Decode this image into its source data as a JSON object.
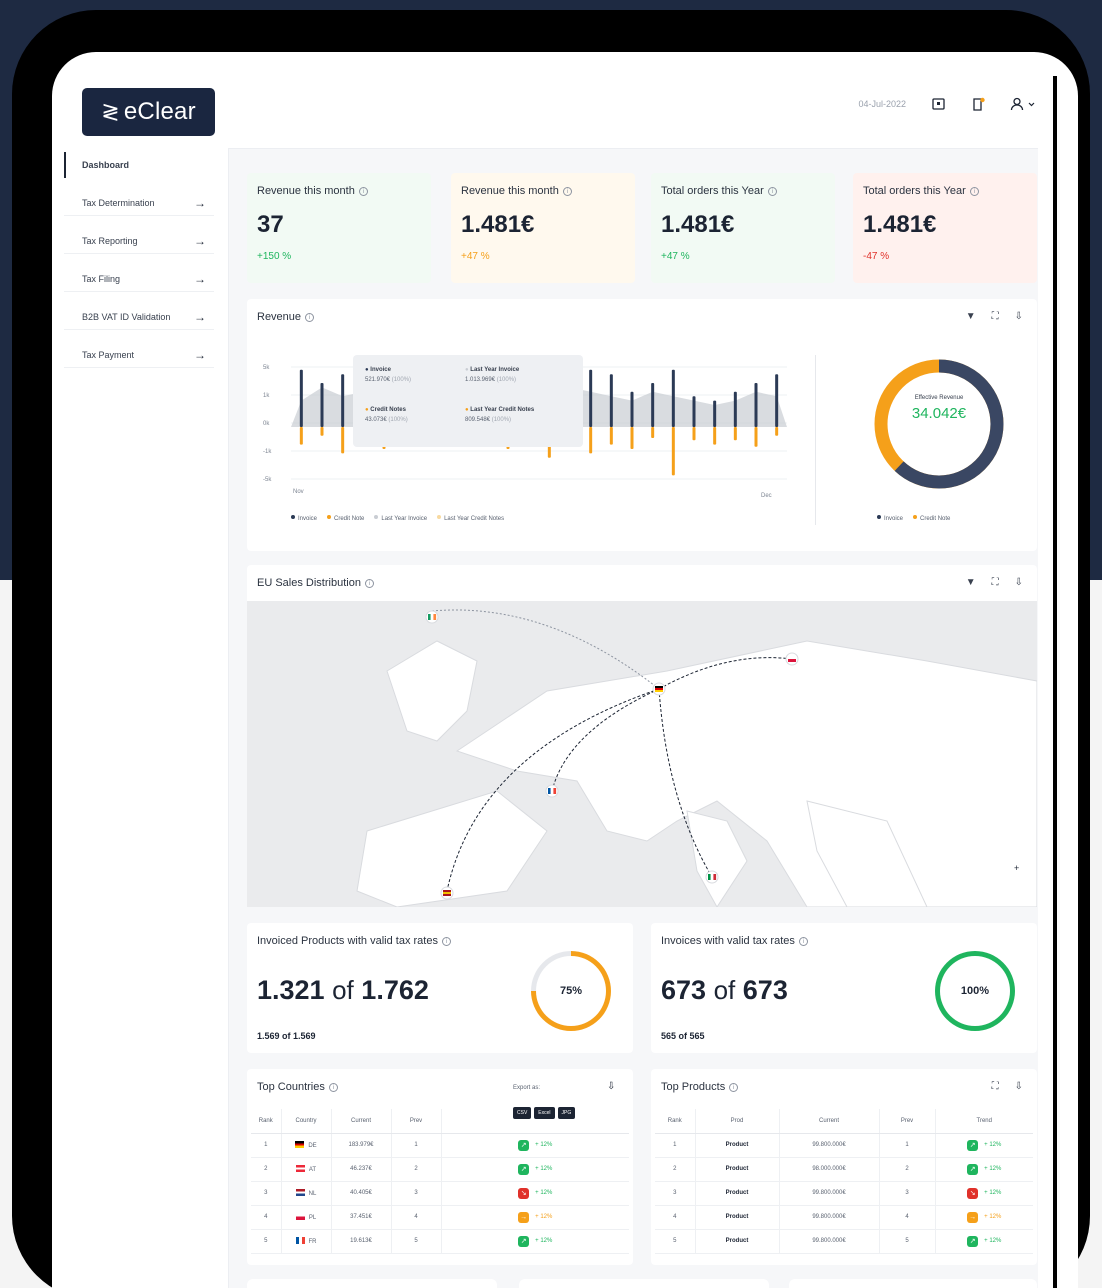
{
  "app": {
    "logo_text": "eClear",
    "date": "04-Jul-2022",
    "icons": [
      "screen-icon",
      "notification-icon",
      "user-icon"
    ]
  },
  "sidebar": {
    "items": [
      {
        "label": "Dashboard",
        "active": true
      },
      {
        "label": "Tax Determination"
      },
      {
        "label": "Tax Reporting"
      },
      {
        "label": "Tax Filing"
      },
      {
        "label": "B2B VAT ID Validation"
      },
      {
        "label": "Tax Payment"
      }
    ]
  },
  "kpis": [
    {
      "title": "Revenue this month",
      "value": "37",
      "change": "+150 %",
      "bg": "#f2faf4",
      "change_color": "#1fb55e"
    },
    {
      "title": "Revenue this month",
      "value": "1.481€",
      "change": "+47 %",
      "bg": "#fff9ee",
      "change_color": "#f5a01a"
    },
    {
      "title": "Total orders this Year",
      "value": "1.481€",
      "change": "+47 %",
      "bg": "#f2faf4",
      "change_color": "#1fb55e"
    },
    {
      "title": "Total orders this Year",
      "value": "1.481€",
      "change": "-47 %",
      "bg": "#fff1ee",
      "change_color": "#e0312a"
    }
  ],
  "revenue": {
    "title": "Revenue",
    "tooltip": {
      "invoice_label": "Invoice",
      "invoice_value": "521.970€",
      "invoice_pct": "(100%)",
      "last_year_invoice_label": "Last Year Invoice",
      "last_year_invoice_value": "1.013.969€",
      "last_year_invoice_pct": "(100%)",
      "credit_notes_label": "Credit Notes",
      "credit_notes_value": "43.073€",
      "credit_notes_pct": "(100%)",
      "last_year_credit_notes_label": "Last Year Credit Notes",
      "last_year_credit_notes_value": "809.548€",
      "last_year_credit_notes_pct": "(100%)"
    },
    "legend": [
      "Invoice",
      "Credit Note",
      "Last Year Invoice",
      "Last Year Credit Notes"
    ],
    "donut": {
      "label": "Effective Revenue",
      "value": "34.042€",
      "legend": [
        "Invoice",
        "Credit Note"
      ],
      "invoice_share": 0.62
    }
  },
  "chart_data": {
    "type": "bar",
    "x_start_label": "Nov",
    "x_end_label": "Dec",
    "y_tick_labels": [
      "5k",
      "1k",
      "0k",
      "-1k",
      "-5k"
    ],
    "series": [
      {
        "name": "Invoice",
        "values": [
          2.6,
          2.0,
          2.4,
          1.6,
          1.8,
          1.2,
          1.0,
          0.8,
          1.2,
          0.6,
          0.8,
          1.4,
          2.0,
          2.2,
          2.6,
          2.4,
          1.6,
          2.0,
          2.6,
          1.4,
          1.2,
          1.6,
          2.0,
          2.4
        ]
      },
      {
        "name": "Credit Note",
        "values": [
          -0.8,
          -0.4,
          -1.2,
          -0.6,
          -1.0,
          -0.5,
          -0.8,
          -0.6,
          -0.9,
          -0.7,
          -1.0,
          -0.8,
          -1.4,
          -0.6,
          -1.2,
          -0.8,
          -1.0,
          -0.5,
          -2.2,
          -0.6,
          -0.8,
          -0.6,
          -0.9,
          -0.4
        ]
      },
      {
        "name": "Last Year Invoice",
        "values": [
          1.2,
          1.8,
          1.4,
          1.6,
          1.2,
          1.0,
          1.4,
          1.2,
          1.6,
          1.8,
          2.0,
          2.2,
          2.6,
          1.8,
          1.6,
          1.4,
          1.2,
          1.6,
          1.4,
          1.2,
          1.0,
          1.2,
          1.6,
          1.4
        ]
      }
    ],
    "colors": {
      "invoice": "#2b3a55",
      "credit": "#f5a01a",
      "last_year": "#c9cdd3"
    }
  },
  "eu_sales": {
    "title": "EU Sales Distribution",
    "markers": [
      "Ireland",
      "Poland",
      "Germany",
      "France",
      "Spain",
      "Italy"
    ]
  },
  "invoiced_products": {
    "title": "Invoiced Products with valid tax rates",
    "count": "1.321",
    "of_text": "of",
    "total": "1.762",
    "sub": "1.569 of 1.569",
    "percent_label": "75%",
    "percent": 0.75,
    "ring_color": "#f5a01a"
  },
  "invoices_valid": {
    "title": "Invoices with valid tax rates",
    "count": "673",
    "of_text": "of",
    "total": "673",
    "sub": "565 of 565",
    "percent_label": "100%",
    "percent": 1.0,
    "ring_color": "#1fb55e"
  },
  "top_countries": {
    "title": "Top Countries",
    "export_label": "Export as:",
    "export_buttons": [
      "CSV",
      "Excel",
      "JPG"
    ],
    "headers": [
      "Rank",
      "Country",
      "Current",
      "Prev"
    ],
    "rows": [
      {
        "rank": "1",
        "country": "DE",
        "current": "183.979€",
        "prev": "1",
        "trend": "+ 12%",
        "trend_color": "#1fb55e",
        "trend_icon": "↗"
      },
      {
        "rank": "2",
        "country": "AT",
        "current": "46.237€",
        "prev": "2",
        "trend": "+ 12%",
        "trend_color": "#1fb55e",
        "trend_icon": "↗"
      },
      {
        "rank": "3",
        "country": "NL",
        "current": "40.405€",
        "prev": "3",
        "trend": "+ 12%",
        "trend_color": "#e0312a",
        "trend_icon": "↘"
      },
      {
        "rank": "4",
        "country": "PL",
        "current": "37.451€",
        "prev": "4",
        "trend": "+ 12%",
        "trend_color": "#f5a01a",
        "trend_icon": "→"
      },
      {
        "rank": "5",
        "country": "FR",
        "current": "19.613€",
        "prev": "5",
        "trend": "+ 12%",
        "trend_color": "#1fb55e",
        "trend_icon": "↗"
      }
    ]
  },
  "top_products": {
    "title": "Top Products",
    "headers": [
      "Rank",
      "Prod",
      "Current",
      "Prev",
      "Trend"
    ],
    "rows": [
      {
        "rank": "1",
        "product": "Product",
        "current": "99.800.000€",
        "prev": "1",
        "trend": "+ 12%",
        "trend_color": "#1fb55e",
        "trend_icon": "↗"
      },
      {
        "rank": "2",
        "product": "Product",
        "current": "98.000.000€",
        "prev": "2",
        "trend": "+ 12%",
        "trend_color": "#1fb55e",
        "trend_icon": "↗"
      },
      {
        "rank": "3",
        "product": "Product",
        "current": "99.800.000€",
        "prev": "3",
        "trend": "+ 12%",
        "trend_color": "#e0312a",
        "trend_icon": "↘"
      },
      {
        "rank": "4",
        "product": "Product",
        "current": "99.800.000€",
        "prev": "4",
        "trend": "+ 12%",
        "trend_color": "#f5a01a",
        "trend_icon": "→"
      },
      {
        "rank": "5",
        "product": "Product",
        "current": "99.800.000€",
        "prev": "5",
        "trend": "+ 12%",
        "trend_color": "#1fb55e",
        "trend_icon": "↗"
      }
    ]
  }
}
